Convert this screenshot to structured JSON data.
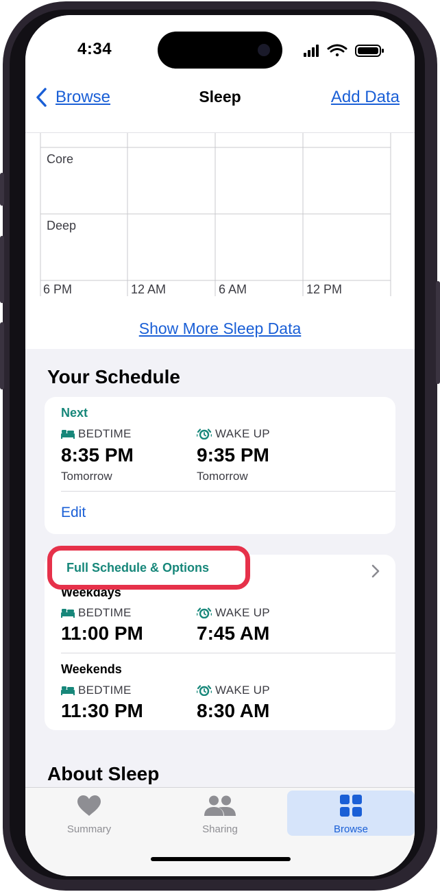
{
  "status_bar": {
    "time": "4:34"
  },
  "nav": {
    "back_label": "Browse",
    "title": "Sleep",
    "action_label": "Add Data"
  },
  "chart": {
    "stages": [
      "Core",
      "Deep"
    ],
    "time_ticks": [
      "6 PM",
      "12 AM",
      "6 AM",
      "12 PM"
    ]
  },
  "show_more_label": "Show More Sleep Data",
  "schedule": {
    "title": "Your Schedule",
    "next": {
      "heading": "Next",
      "bedtime_label": "BEDTIME",
      "bedtime_time": "8:35 PM",
      "bedtime_day": "Tomorrow",
      "wake_label": "WAKE UP",
      "wake_time": "9:35 PM",
      "wake_day": "Tomorrow",
      "edit_label": "Edit"
    },
    "full": {
      "heading": "Full Schedule & Options",
      "groups": [
        {
          "name": "Weekdays",
          "bedtime_label": "BEDTIME",
          "bedtime_time": "11:00 PM",
          "wake_label": "WAKE UP",
          "wake_time": "7:45 AM"
        },
        {
          "name": "Weekends",
          "bedtime_label": "BEDTIME",
          "bedtime_time": "11:30 PM",
          "wake_label": "WAKE UP",
          "wake_time": "8:30 AM"
        }
      ]
    }
  },
  "about_title": "About Sleep",
  "tabs": [
    {
      "label": "Summary",
      "icon": "heart-icon"
    },
    {
      "label": "Sharing",
      "icon": "people-icon"
    },
    {
      "label": "Browse",
      "icon": "grid-icon",
      "active": true
    }
  ],
  "colors": {
    "accent": "#17877a",
    "link": "#1a5fd6",
    "highlight": "#e6314a"
  }
}
